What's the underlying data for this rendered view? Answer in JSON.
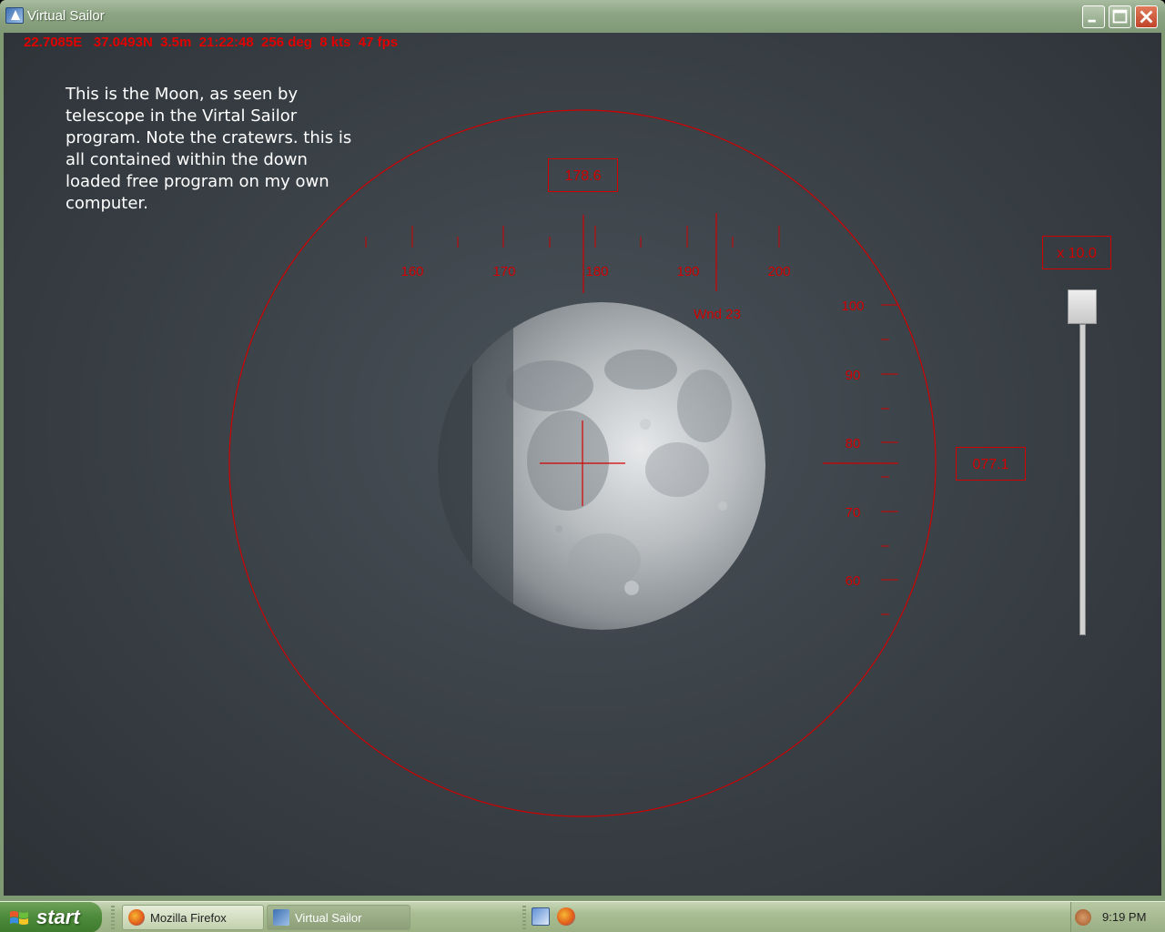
{
  "window": {
    "title": "Virtual Sailor"
  },
  "status": {
    "text": "22.7085E   37.0493N  3.5m  21:22:48  256 deg  8 kts  47 fps"
  },
  "caption": {
    "text": "This is the Moon, as seen by telescope in the Virtal Sailor program. Note the cratewrs. this is all contained within the down loaded free program on my own computer."
  },
  "hud": {
    "heading_readout": "178.6",
    "zoom_readout": "x 10.0",
    "elevation_readout": "077.1",
    "wind_label": "Wnd 23",
    "heading_ticks": [
      "160",
      "170",
      "180",
      "190",
      "200"
    ],
    "elevation_ticks": [
      "100",
      "90",
      "80",
      "70",
      "60"
    ],
    "color": "#d00000"
  },
  "zoom_slider": {
    "level": 1.0
  },
  "taskbar": {
    "start_label": "start",
    "items": [
      {
        "label": "Mozilla Firefox",
        "icon": "firefox-icon"
      },
      {
        "label": "Virtual Sailor",
        "icon": "virtual-sailor-icon"
      }
    ],
    "clock": "9:19 PM"
  }
}
